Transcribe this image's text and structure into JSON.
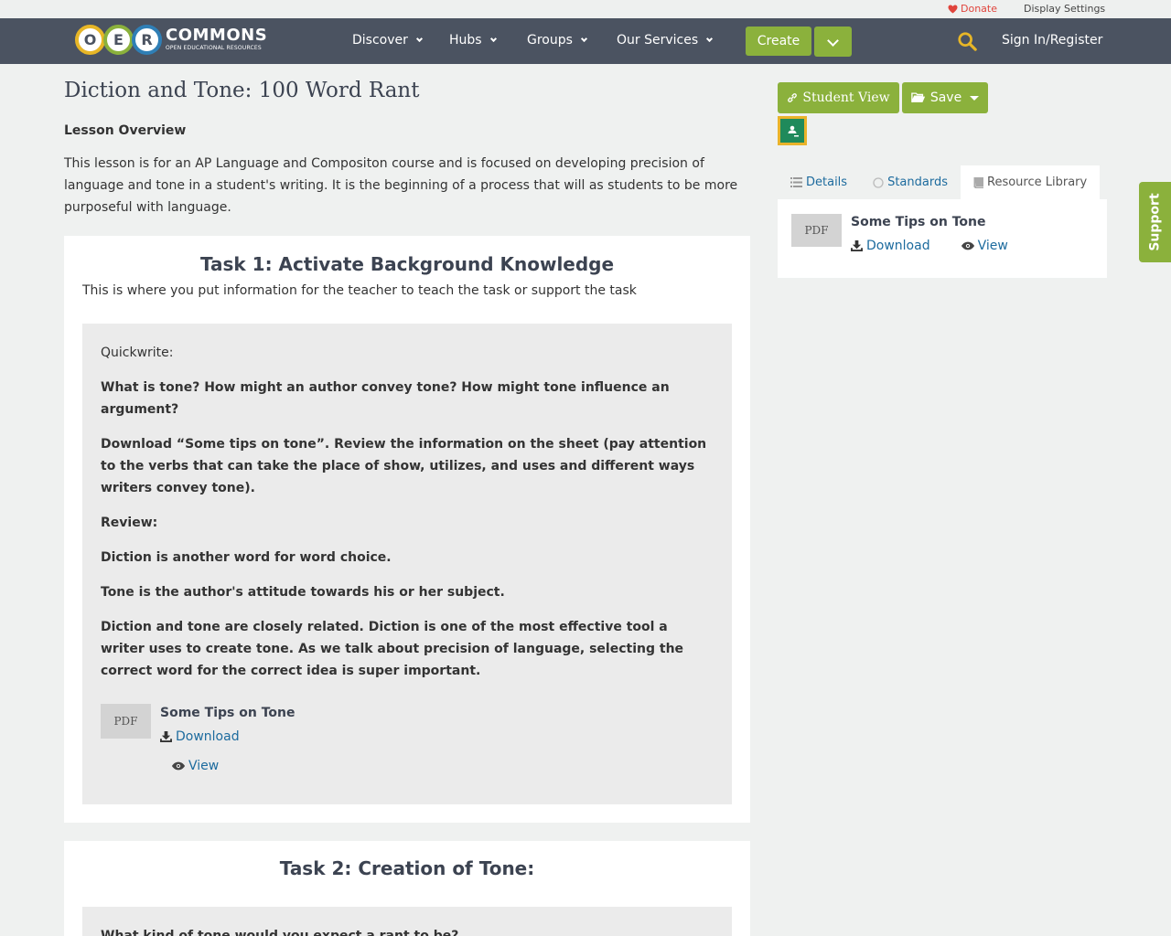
{
  "utility": {
    "donate": "Donate",
    "display_settings": "Display Settings"
  },
  "logo": {
    "letters": [
      "O",
      "E",
      "R"
    ],
    "title": "COMMONS",
    "subtitle": "OPEN EDUCATIONAL RESOURCES"
  },
  "nav": {
    "items": [
      {
        "label": "Discover"
      },
      {
        "label": "Hubs"
      },
      {
        "label": "Groups"
      },
      {
        "label": "Our Services"
      }
    ],
    "create": "Create",
    "signin": "Sign In/Register"
  },
  "page": {
    "title": "Diction and Tone: 100 Word Rant",
    "overview_label": "Lesson Overview",
    "overview": "This lesson is for an AP Language and Compositon course and is focused on developing precision of language and tone in a student's writing.  It is the beginning of a process that will as students to be more purposeful with language."
  },
  "task1": {
    "title": "Task 1: Activate Background Knowledge",
    "note": "This is where you put information for the teacher to teach the task or support the task",
    "paragraphs": [
      "Quickwrite:",
      "What is tone?  How might an author convey tone? How might tone influence an argument?",
      "Download “Some tips on tone”.  Review the information on the sheet (pay attention to the verbs that can take the place of show, utilizes, and uses and different ways writers convey tone).",
      "Review:",
      "Diction is another word for word choice.",
      "Tone is the author's attitude towards his or her subject.",
      "Diction and tone are closely related.  Diction is one of the most effective tool a writer uses to create tone.  As we talk about precision of language, selecting the correct word for the correct idea is super important."
    ],
    "resource": {
      "badge": "PDF",
      "title": "Some Tips on Tone",
      "download": "Download",
      "view": "View"
    }
  },
  "task2": {
    "title": "Task 2: Creation of Tone:",
    "first_line": "What kind of tone would you expect a rant to be?"
  },
  "sidebar": {
    "student_view": "Student View",
    "save": "Save",
    "tabs": [
      {
        "label": "Details"
      },
      {
        "label": "Standards"
      },
      {
        "label": "Resource Library"
      }
    ],
    "resource": {
      "badge": "PDF",
      "title": "Some Tips on Tone",
      "download": "Download",
      "view": "View"
    }
  },
  "support": "Support",
  "colors": {
    "nav_bg": "#4b5361",
    "accent_green": "#8bb13c",
    "link_blue": "#1d6b9e",
    "donate_red": "#e0443c"
  }
}
